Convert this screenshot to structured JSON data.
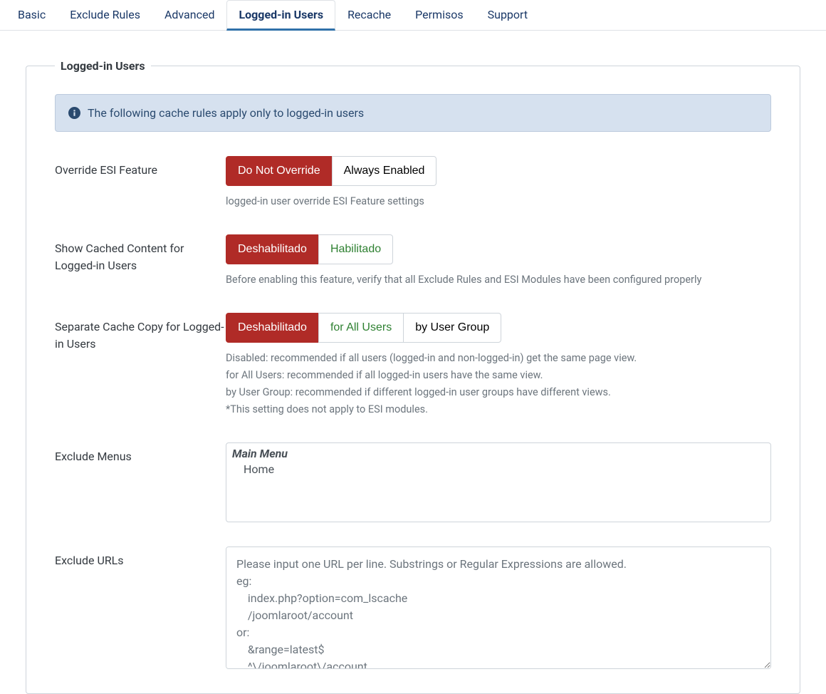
{
  "tabs": {
    "basic": "Basic",
    "exclude_rules": "Exclude Rules",
    "advanced": "Advanced",
    "logged_in_users": "Logged-in Users",
    "recache": "Recache",
    "permisos": "Permisos",
    "support": "Support"
  },
  "legend": "Logged-in Users",
  "alert_text": "The following cache rules apply only to logged-in users",
  "override_esi": {
    "label": "Override ESI Feature",
    "opt_no_override": "Do Not Override",
    "opt_always": "Always Enabled",
    "help": "logged-in user override ESI Feature settings"
  },
  "show_cached": {
    "label": "Show Cached Content for Logged-in Users",
    "opt_disabled": "Deshabilitado",
    "opt_enabled": "Habilitado",
    "help": "Before enabling this feature, verify that all Exclude Rules and ESI Modules have been configured properly"
  },
  "separate_copy": {
    "label": "Separate Cache Copy for Logged-in Users",
    "opt_disabled": "Deshabilitado",
    "opt_all": "for All Users",
    "opt_group": "by User Group",
    "help1": "Disabled: recommended if all users (logged-in and non-logged-in) get the same page view.",
    "help2": "for All Users: recommended if all logged-in users have the same view.",
    "help3": "by User Group: recommended if different logged-in user groups have different views.",
    "help4": "*This setting does not apply to ESI modules."
  },
  "exclude_menus": {
    "label": "Exclude Menus",
    "group_header": "Main Menu",
    "item_home": "Home"
  },
  "exclude_urls": {
    "label": "Exclude URLs",
    "placeholder": "Please input one URL per line. Substrings or Regular Expressions are allowed.\neg:\n    index.php?option=com_lscache\n    /joomlaroot/account\nor:\n    &range=latest$\n    ^\\/joomlaroot\\/account"
  }
}
